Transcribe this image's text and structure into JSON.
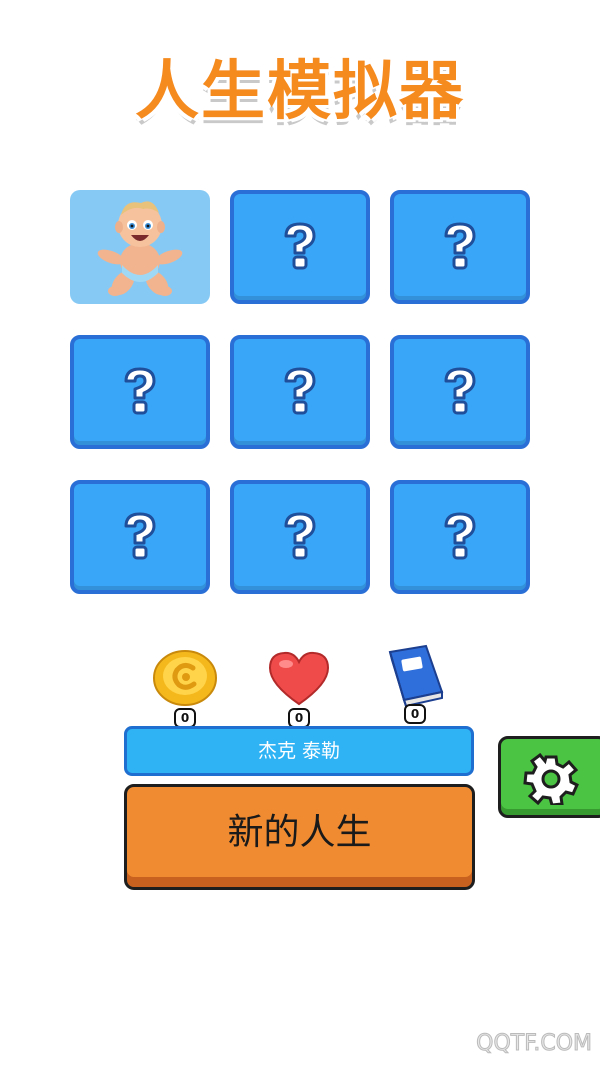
{
  "app": {
    "title": "人生模拟器"
  },
  "grid": {
    "slots": [
      {
        "state": "unlocked",
        "icon": "baby-character"
      },
      {
        "state": "locked",
        "icon": "question-mark-icon"
      },
      {
        "state": "locked",
        "icon": "question-mark-icon"
      },
      {
        "state": "locked",
        "icon": "question-mark-icon"
      },
      {
        "state": "locked",
        "icon": "question-mark-icon"
      },
      {
        "state": "locked",
        "icon": "question-mark-icon"
      },
      {
        "state": "locked",
        "icon": "question-mark-icon"
      },
      {
        "state": "locked",
        "icon": "question-mark-icon"
      },
      {
        "state": "locked",
        "icon": "question-mark-icon"
      }
    ]
  },
  "stats": {
    "coin": {
      "icon": "coin-icon",
      "count": "0"
    },
    "heart": {
      "icon": "heart-icon",
      "count": "0"
    },
    "book": {
      "icon": "book-icon",
      "count": "0"
    }
  },
  "player": {
    "name": "杰克 泰勒"
  },
  "actions": {
    "new_life_label": "新的人生",
    "settings_icon": "gear-icon"
  },
  "watermark": "QQTF.COM",
  "colors": {
    "title": "#f58a1f",
    "slot_bg": "#3aa6f7",
    "slot_border": "#2a6fd6",
    "name_bar": "#2fb3f5",
    "new_life_button": "#f08b32",
    "settings_button": "#4bc443"
  }
}
